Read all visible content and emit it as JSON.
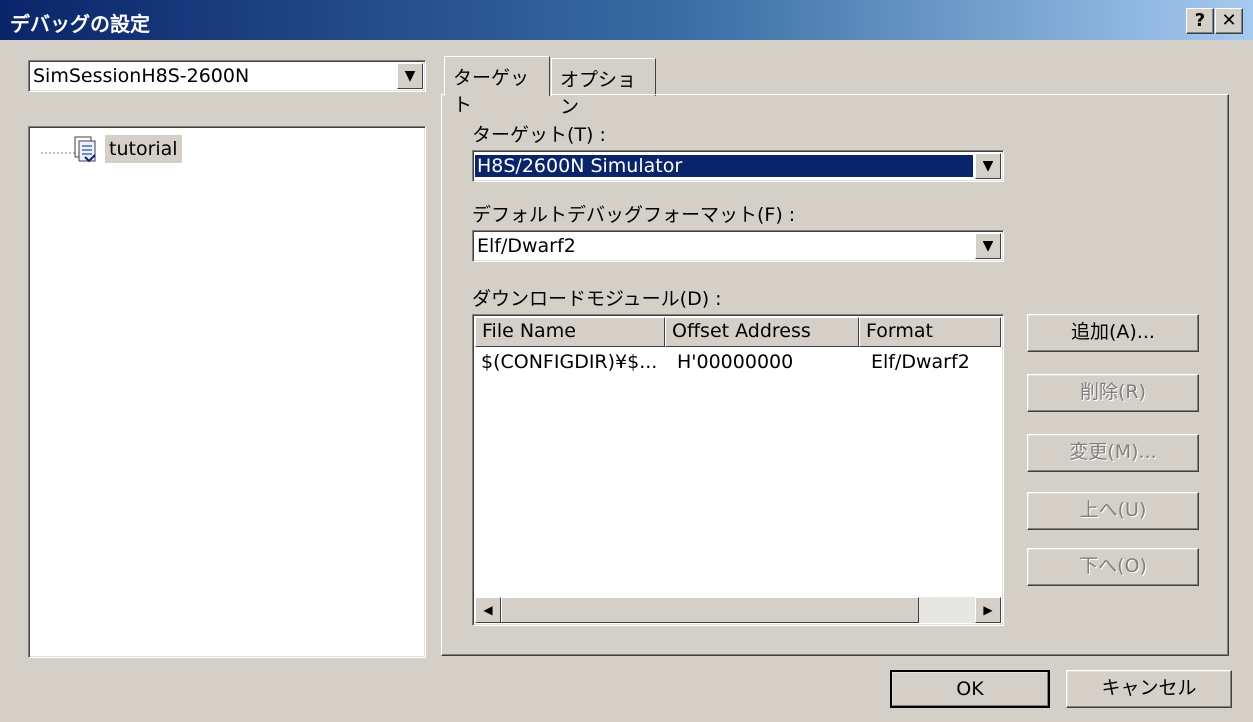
{
  "window": {
    "title": "デバッグの設定",
    "help_label": "?",
    "close_label": "✕"
  },
  "session": {
    "selected": "SimSessionH8S-2600N"
  },
  "tree": {
    "items": [
      {
        "label": "tutorial",
        "icon": "project-icon"
      }
    ]
  },
  "tabs": [
    {
      "label": "ターゲット",
      "active": true
    },
    {
      "label": "オプション",
      "active": false
    }
  ],
  "target": {
    "label": "ターゲット(T) :",
    "value": "H8S/2600N Simulator"
  },
  "format": {
    "label": "デフォルトデバッグフォーマット(F) :",
    "value": "Elf/Dwarf2"
  },
  "modules": {
    "label": "ダウンロードモジュール(D) :",
    "columns": [
      "File Name",
      "Offset Address",
      "Format"
    ],
    "rows": [
      [
        "$(CONFIGDIR)¥$...",
        "H'00000000",
        "Elf/Dwarf2"
      ]
    ]
  },
  "buttons": {
    "add": "追加(A)...",
    "remove": "削除(R)",
    "modify": "変更(M)...",
    "up": "上へ(U)",
    "down": "下へ(O)",
    "ok": "OK",
    "cancel": "キャンセル"
  },
  "colors": {
    "selection": "#0a246a",
    "face": "#d4d0c8"
  }
}
